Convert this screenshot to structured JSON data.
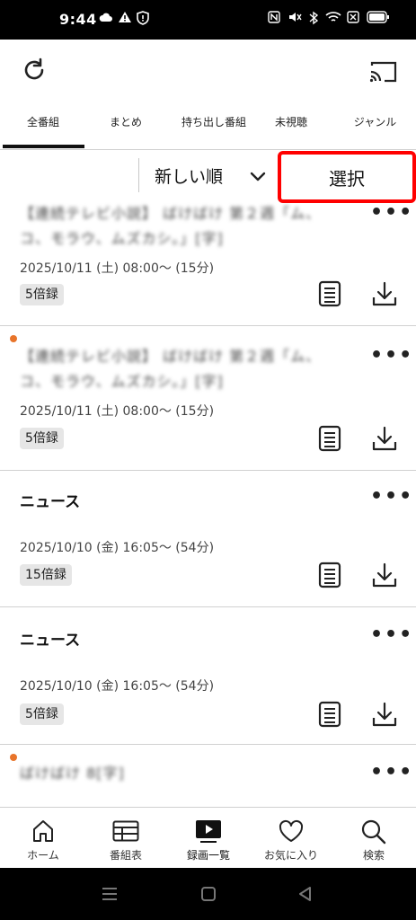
{
  "status_bar": {
    "time": "9:44",
    "icons_left": [
      "cloud-icon",
      "warning-icon",
      "shield-icon"
    ],
    "icons_right": [
      "nfc-icon",
      "mute-icon",
      "bluetooth-icon",
      "wifi-icon",
      "close-box-icon",
      "battery-icon"
    ]
  },
  "app_bar": {
    "left_icon": "refresh-icon",
    "right_icon": "cast-icon"
  },
  "tabs": [
    {
      "label": "全番組",
      "active": true
    },
    {
      "label": "まとめ"
    },
    {
      "label": "持ち出し番組"
    },
    {
      "label": "未視聴"
    },
    {
      "label": "ジャンル"
    }
  ],
  "sort": {
    "label": "新しい順",
    "select_label": "選択"
  },
  "recordings": [
    {
      "title": "【連続テレビ小説】 ばけばけ 第２週「ム、コ、モラウ、ムズカシ。」[字]",
      "title_blurred": true,
      "date": "2025/10/11 (土) 08:00〜 (15分)",
      "badge": "5倍録",
      "new": false
    },
    {
      "title": "【連続テレビ小説】 ばけばけ 第２週「ム、コ、モラウ、ムズカシ。」[字]",
      "title_blurred": true,
      "date": "2025/10/11 (土) 08:00〜 (15分)",
      "badge": "5倍録",
      "new": true
    },
    {
      "title": "ニュース",
      "title_blurred": false,
      "date": "2025/10/10 (金) 16:05〜 (54分)",
      "badge": "15倍録",
      "new": false
    },
    {
      "title": "ニュース",
      "title_blurred": false,
      "date": "2025/10/10 (金) 16:05〜 (54分)",
      "badge": "5倍録",
      "new": false
    },
    {
      "title": "ばけばけ 8[字]",
      "title_blurred": true,
      "date": "",
      "badge": "",
      "new": true
    }
  ],
  "more_label": "•••",
  "bottom_nav": [
    {
      "label": "ホーム",
      "icon": "home-icon"
    },
    {
      "label": "番組表",
      "icon": "guide-icon"
    },
    {
      "label": "録画一覧",
      "icon": "recordings-icon",
      "active": true
    },
    {
      "label": "お気に入り",
      "icon": "heart-icon"
    },
    {
      "label": "検索",
      "icon": "search-icon"
    }
  ],
  "system_nav": [
    "menu-icon",
    "home-square-icon",
    "back-icon"
  ],
  "colors": {
    "accent_dot": "#e8742a",
    "select_border": "#ff0000",
    "badge_bg": "#e6e6e6"
  }
}
